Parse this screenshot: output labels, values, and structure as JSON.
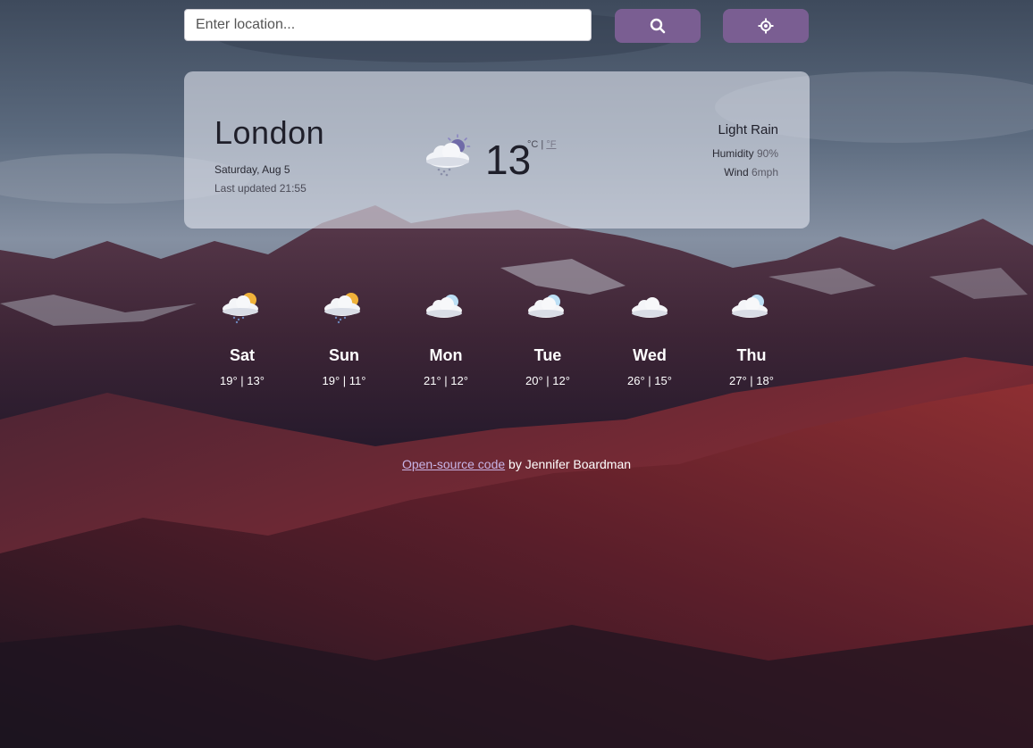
{
  "search": {
    "placeholder": "Enter location..."
  },
  "buttons": {
    "search_icon": "search-icon",
    "locate_icon": "crosshair-icon"
  },
  "current": {
    "city": "London",
    "date": "Saturday, Aug 5",
    "updated": "Last updated 21:55",
    "temp": "13",
    "unit_c": "°C",
    "unit_sep": " | ",
    "unit_f": "°F",
    "description": "Light Rain",
    "humidity_label": "Humidity",
    "humidity_value": "90%",
    "wind_label": "Wind",
    "wind_value": "6mph",
    "icon": "night-rain-cloud-icon"
  },
  "forecast": [
    {
      "day": "Sat",
      "temps": "19° | 13°",
      "icon": "rain-sun-cloud-icon"
    },
    {
      "day": "Sun",
      "temps": "19° | 11°",
      "icon": "rain-sun-cloud-icon"
    },
    {
      "day": "Mon",
      "temps": "21° | 12°",
      "icon": "cloudy-icon"
    },
    {
      "day": "Tue",
      "temps": "20° | 12°",
      "icon": "cloudy-icon"
    },
    {
      "day": "Wed",
      "temps": "26° | 15°",
      "icon": "cloud-icon"
    },
    {
      "day": "Thu",
      "temps": "27° | 18°",
      "icon": "cloudy-icon"
    }
  ],
  "footer": {
    "link_text": "Open-source code",
    "byline": " by Jennifer Boardman"
  },
  "colors": {
    "button": "#7a5e92",
    "link": "#c8b4e6"
  }
}
